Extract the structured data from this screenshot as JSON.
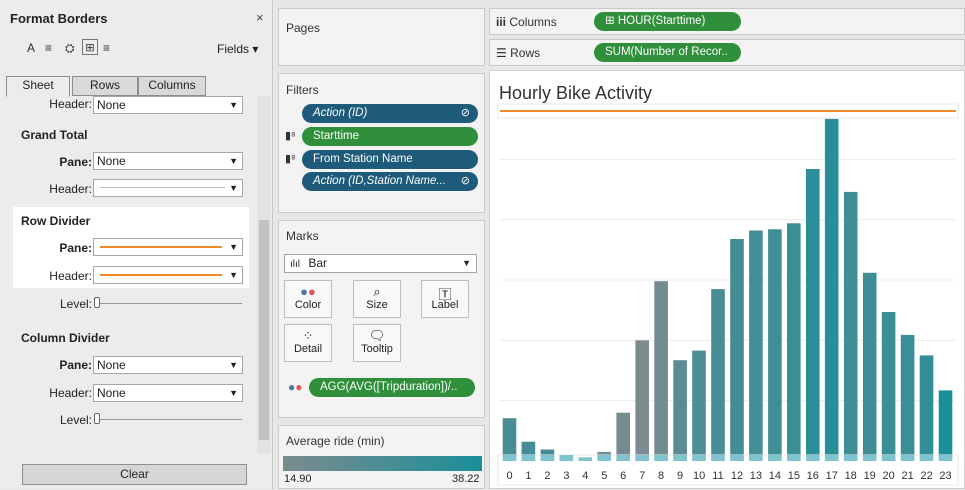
{
  "format_panel": {
    "title": "Format Borders",
    "close": "×",
    "toolbar": {
      "font": "A",
      "align": "≡",
      "shading": "⛭",
      "borders": "⊞",
      "lines": "≡",
      "fields": "Fields ▾"
    },
    "tabs": [
      "Sheet",
      "Rows",
      "Columns"
    ],
    "top_header_label": "Header:",
    "top_header_value": "None",
    "grand_total": {
      "heading": "Grand Total",
      "pane_label": "Pane:",
      "pane_value": "None",
      "header_label": "Header:"
    },
    "row_divider": {
      "heading": "Row Divider",
      "pane_label": "Pane:",
      "header_label": "Header:",
      "level_label": "Level:",
      "line_color": "#f08a24"
    },
    "column_divider": {
      "heading": "Column Divider",
      "pane_label": "Pane:",
      "pane_value": "None",
      "header_label": "Header:",
      "header_value": "None",
      "level_label": "Level:"
    },
    "clear_button": "Clear"
  },
  "pages": {
    "title": "Pages"
  },
  "filters": {
    "title": "Filters",
    "pills": [
      {
        "label": "Action (ID)",
        "kind": "blue",
        "italic": true,
        "icon": "⊘"
      },
      {
        "label": "Starttime",
        "kind": "green",
        "italic": false,
        "icon": ""
      },
      {
        "label": "From Station Name",
        "kind": "blue",
        "italic": false,
        "icon": ""
      },
      {
        "label": "Action (ID,Station Name...",
        "kind": "blue",
        "italic": true,
        "icon": "⊘"
      }
    ]
  },
  "marks": {
    "title": "Marks",
    "mark_type": "Bar",
    "buttons": [
      {
        "label": "Color",
        "icon": "color-dots-icon"
      },
      {
        "label": "Size",
        "icon": "size-icon"
      },
      {
        "label": "Label",
        "icon": "label-icon"
      },
      {
        "label": "Detail",
        "icon": "detail-icon"
      },
      {
        "label": "Tooltip",
        "icon": "tooltip-icon"
      }
    ],
    "color_pill": "AGG(AVG([Tripduration])/.."
  },
  "legend": {
    "title": "Average ride (min)",
    "min": "14.90",
    "max": "38.22",
    "color_low": "#7b8b8e",
    "color_high": "#1a8f9a"
  },
  "columns_shelf": {
    "label": "Columns",
    "pill": "HOUR(Starttime)"
  },
  "rows_shelf": {
    "label": "Rows",
    "pill": "SUM(Number of Recor.."
  },
  "chart_data": {
    "type": "bar",
    "title": "Hourly Bike Activity",
    "categories": [
      "0",
      "1",
      "2",
      "3",
      "4",
      "5",
      "6",
      "7",
      "8",
      "9",
      "10",
      "11",
      "12",
      "13",
      "14",
      "15",
      "16",
      "17",
      "18",
      "19",
      "20",
      "21",
      "22",
      "23"
    ],
    "values": [
      71,
      32,
      19,
      10,
      6,
      15,
      80,
      200,
      298,
      167,
      183,
      285,
      368,
      382,
      384,
      394,
      484,
      567,
      446,
      312,
      247,
      209,
      175,
      117
    ],
    "color_values": [
      26,
      27,
      27,
      28,
      20,
      18,
      16,
      15,
      17,
      22,
      25,
      26,
      27,
      27,
      28,
      29,
      32,
      33,
      28,
      28,
      29,
      29,
      31,
      36
    ],
    "ylim": [
      0,
      600
    ],
    "grid": true,
    "highlight_color": "#f08a24"
  }
}
